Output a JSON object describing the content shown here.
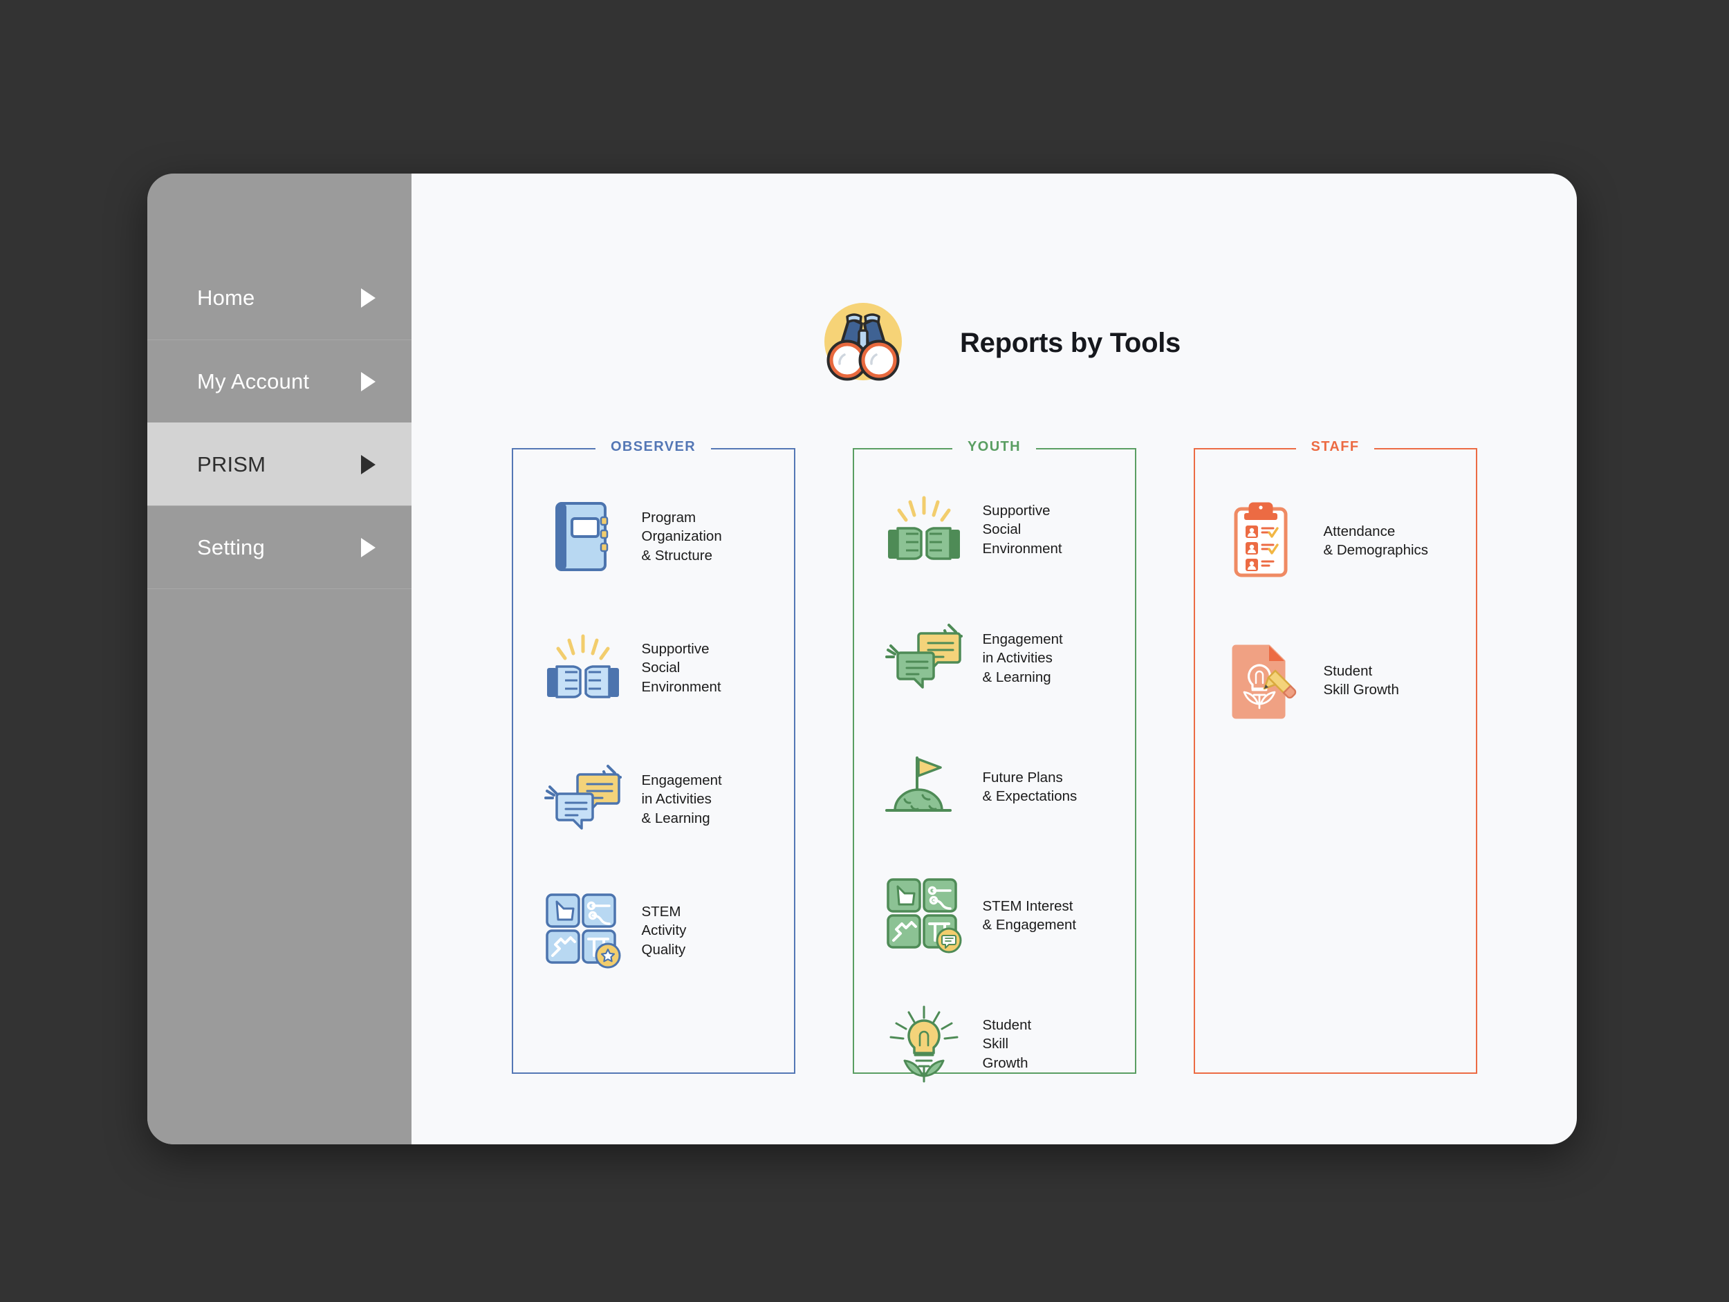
{
  "theme": {
    "desktop_bg": "#333333",
    "window_bg": "#f8f9fb",
    "sidebar_bg": "#9b9b9b",
    "sidebar_active_bg": "#d3d3d3",
    "observer_accent": "#5477b5",
    "youth_accent": "#5a9e62",
    "staff_accent": "#ec6b43",
    "yellow": "#f2cd6d",
    "title_color": "#16181d"
  },
  "sidebar": {
    "items": [
      {
        "label": "Home",
        "active": false,
        "icon": "chevron-right-icon"
      },
      {
        "label": "My Account",
        "active": false,
        "icon": "chevron-right-icon"
      },
      {
        "label": "PRISM",
        "active": true,
        "icon": "chevron-right-icon"
      },
      {
        "label": "Setting",
        "active": false,
        "icon": "chevron-right-icon"
      }
    ]
  },
  "header": {
    "title": "Reports by Tools",
    "icon": "binoculars-icon"
  },
  "columns": [
    {
      "key": "observer",
      "label": "OBSERVER",
      "accent": "#5477b5",
      "tools": [
        {
          "label": "Program\nOrganization\n& Structure",
          "icon": "notebook-icon"
        },
        {
          "label": "Supportive\nSocial\nEnvironment",
          "icon": "fist-bump-icon"
        },
        {
          "label": "Engagement\nin Activities\n& Learning",
          "icon": "speech-bubbles-icon"
        },
        {
          "label": "STEM\nActivity\nQuality",
          "icon": "stem-quad-star-icon"
        }
      ]
    },
    {
      "key": "youth",
      "label": "YOUTH",
      "accent": "#5a9e62",
      "tools": [
        {
          "label": "Supportive\nSocial\nEnvironment",
          "icon": "fist-bump-icon"
        },
        {
          "label": "Engagement\nin Activities\n& Learning",
          "icon": "speech-bubbles-icon"
        },
        {
          "label": "Future Plans\n& Expectations",
          "icon": "flag-hill-icon"
        },
        {
          "label": "STEM Interest\n& Engagement",
          "icon": "stem-quad-chat-icon"
        },
        {
          "label": "Student\nSkill\nGrowth",
          "icon": "lightbulb-plant-icon"
        }
      ]
    },
    {
      "key": "staff",
      "label": "STAFF",
      "accent": "#ec6b43",
      "tools": [
        {
          "label": "Attendance\n& Demographics",
          "icon": "clipboard-roster-icon"
        },
        {
          "label": "Student\nSkill Growth",
          "icon": "document-pencil-bulb-icon"
        }
      ]
    }
  ]
}
